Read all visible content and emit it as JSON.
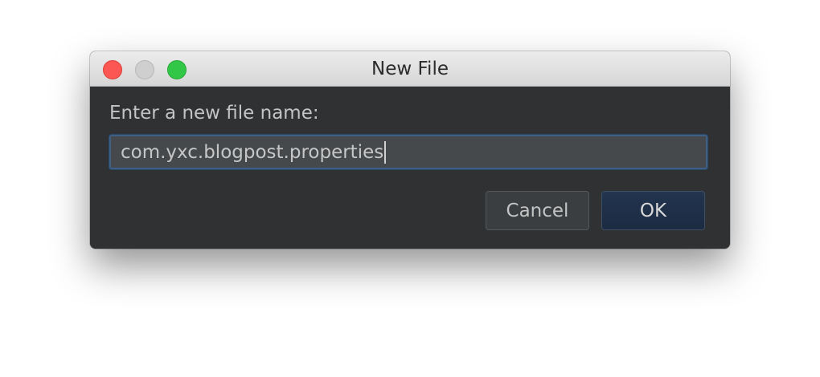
{
  "window": {
    "title": "New File"
  },
  "traffic_lights": [
    {
      "name": "close",
      "color": "#fc5753"
    },
    {
      "name": "minimize",
      "color": "#cfcfcf"
    },
    {
      "name": "zoom",
      "color": "#33c748"
    }
  ],
  "dialog": {
    "prompt": "Enter a new file name:",
    "file_name_value": "com.yxc.blogpost.properties",
    "cancel_label": "Cancel",
    "ok_label": "OK"
  },
  "colors": {
    "dialog_background": "#2f3133",
    "input_focus_border": "#3d5f86",
    "default_button": "#22344f"
  }
}
